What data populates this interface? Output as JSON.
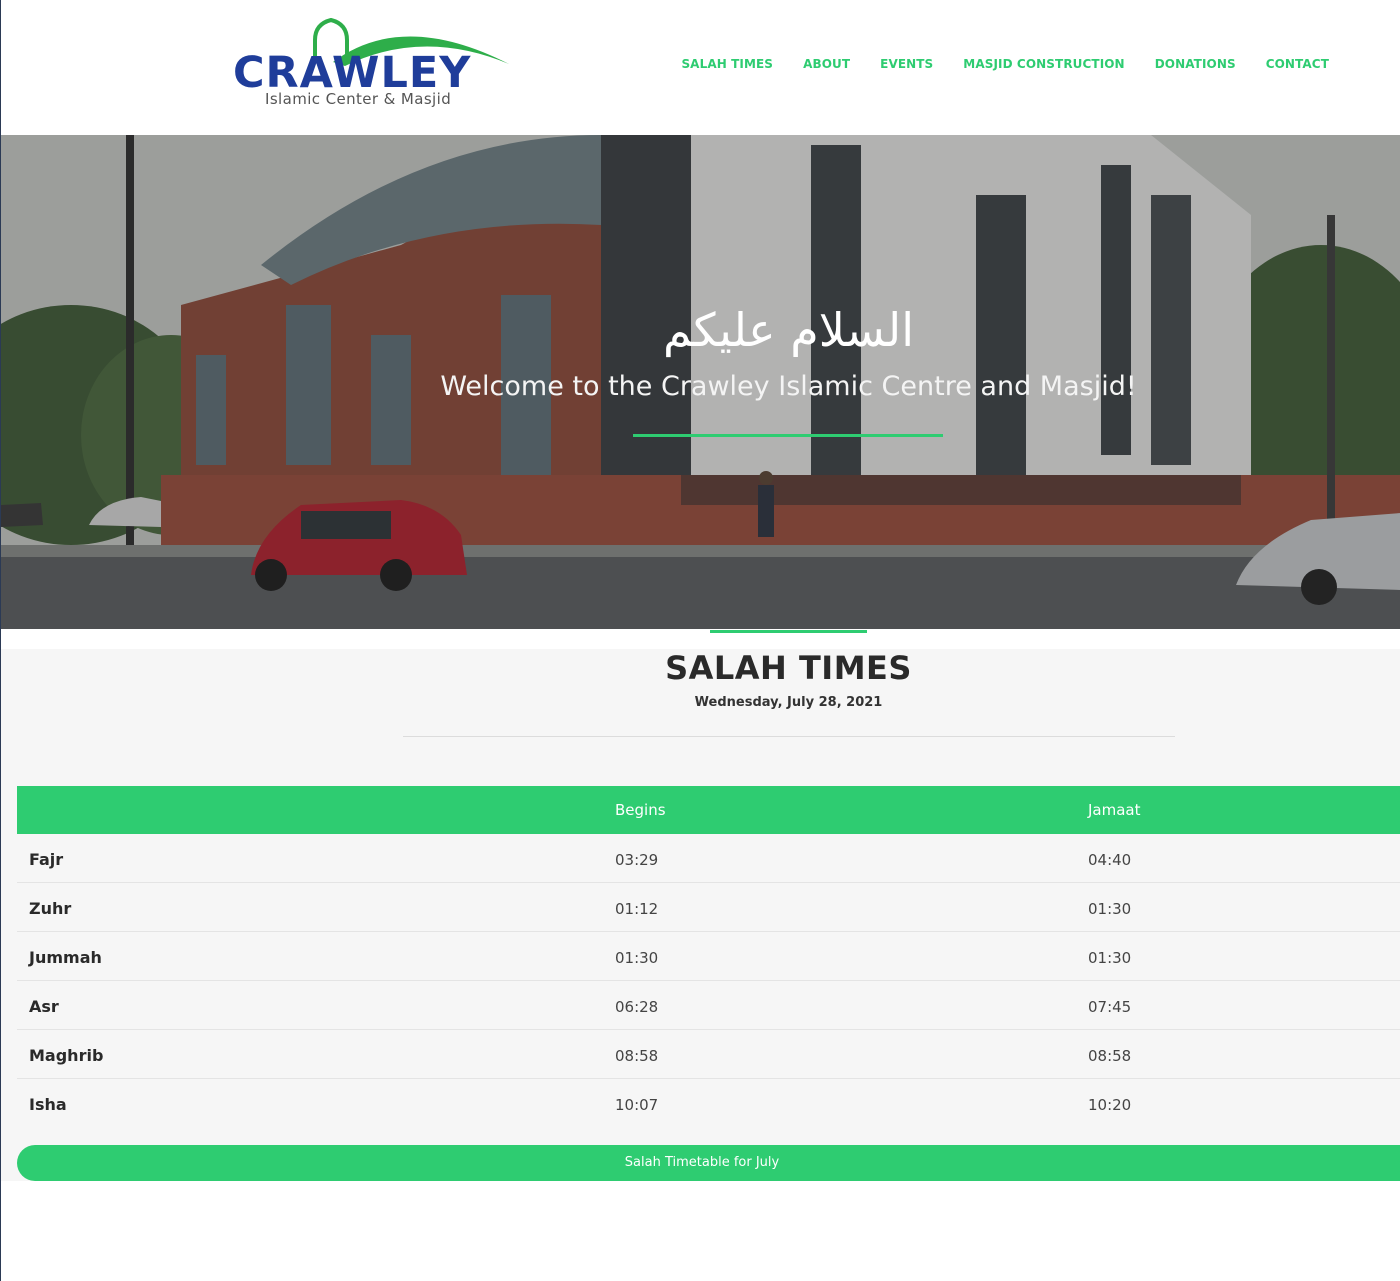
{
  "brand": {
    "wordmark": "CRAWLEY",
    "subtitle": "Islamic Center & Masjid",
    "colors": {
      "blue": "#1f3d9a",
      "green": "#2ecc71"
    }
  },
  "nav": {
    "items": [
      {
        "label": "SALAH TIMES"
      },
      {
        "label": "ABOUT"
      },
      {
        "label": "EVENTS"
      },
      {
        "label": "MASJID CONSTRUCTION"
      },
      {
        "label": "DONATIONS"
      },
      {
        "label": "CONTACT"
      }
    ]
  },
  "hero": {
    "arabic": "السلام عليكم",
    "welcome": "Welcome to the Crawley Islamic Centre and Masjid!"
  },
  "salah": {
    "title": "SALAH TIMES",
    "date": "Wednesday, July 28, 2021",
    "columns": [
      "",
      "Begins",
      "Jamaat"
    ],
    "rows": [
      {
        "name": "Fajr",
        "begins": "03:29",
        "jamaat": "04:40"
      },
      {
        "name": "Zuhr",
        "begins": "01:12",
        "jamaat": "01:30"
      },
      {
        "name": "Jummah",
        "begins": "01:30",
        "jamaat": "01:30"
      },
      {
        "name": "Asr",
        "begins": "06:28",
        "jamaat": "07:45"
      },
      {
        "name": "Maghrib",
        "begins": "08:58",
        "jamaat": "08:58"
      },
      {
        "name": "Isha",
        "begins": "10:07",
        "jamaat": "10:20"
      }
    ],
    "timetable_button": "Salah Timetable for July"
  }
}
